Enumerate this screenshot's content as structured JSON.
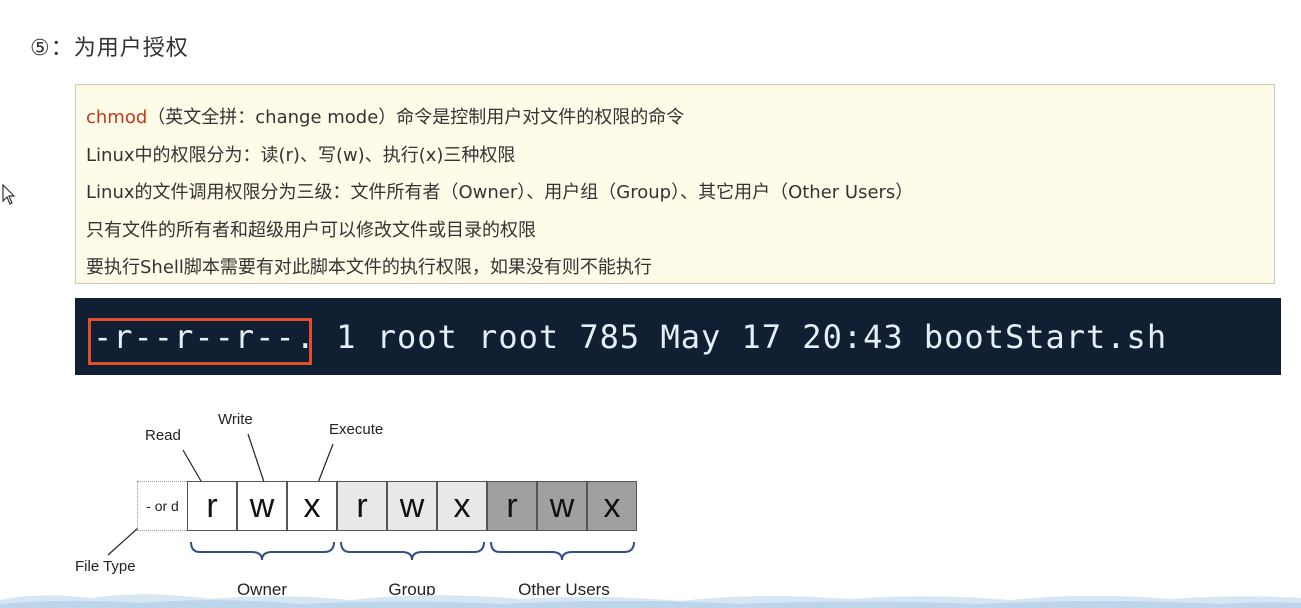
{
  "heading": "⑤：为用户授权",
  "note": {
    "line1_accent": "chmod",
    "line1_rest": "（英文全拼：change mode）命令是控制用户对文件的权限的命令",
    "line2": "Linux中的权限分为：读(r)、写(w)、执行(x)三种权限",
    "line3": "Linux的文件调用权限分为三级：文件所有者（Owner）、用户组（Group）、其它用户（Other Users）",
    "line4": "只有文件的所有者和超级用户可以修改文件或目录的权限",
    "line5": "要执行Shell脚本需要有对此脚本文件的执行权限，如果没有则不能执行"
  },
  "terminal": {
    "line": "-r--r--r--. 1 root root 785 May 17 20:43 bootStart.sh"
  },
  "diagram": {
    "labels": {
      "read": "Read",
      "write": "Write",
      "execute": "Execute",
      "file_type": "File Type"
    },
    "file_type_cell": "- or d",
    "cells": [
      "r",
      "w",
      "x",
      "r",
      "w",
      "x",
      "r",
      "w",
      "x"
    ],
    "groups": [
      "Owner",
      "Group",
      "Other Users"
    ],
    "colors": {
      "owner_bg": "#ffffff",
      "group_bg": "#e8e8ea",
      "other_bg": "#a0a0a0",
      "brace": "#2f4f8a",
      "highlight": "#e0502f"
    }
  }
}
